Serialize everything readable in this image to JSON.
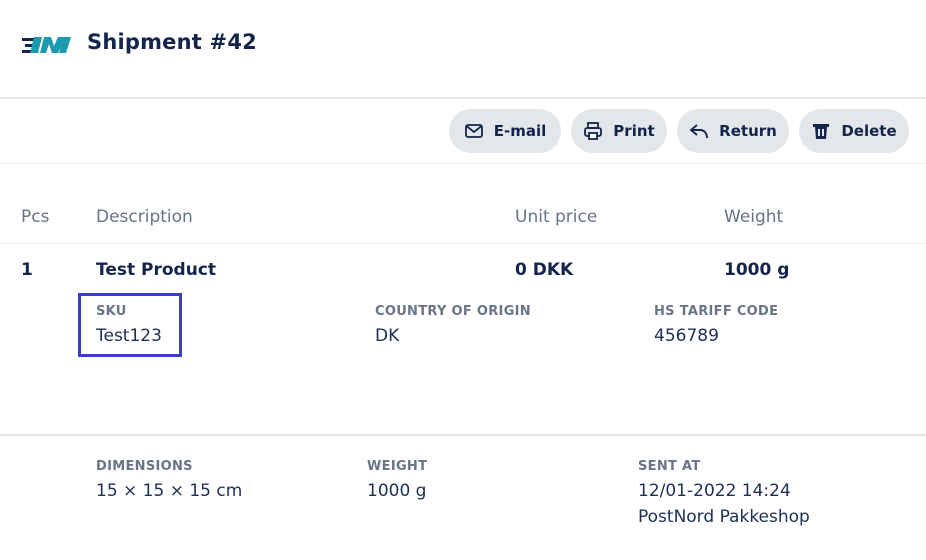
{
  "header": {
    "title": "Shipment #42",
    "logo": "company-logo"
  },
  "toolbar": {
    "email": "E-mail",
    "print": "Print",
    "return": "Return",
    "delete": "Delete"
  },
  "table": {
    "columns": [
      "Pcs",
      "Description",
      "Unit price",
      "Weight"
    ],
    "rows": [
      {
        "pcs": "1",
        "description": "Test Product",
        "unit_price": "0 DKK",
        "weight": "1000 g",
        "details": {
          "sku_label": "SKU",
          "sku": "Test123",
          "origin_label": "COUNTRY OF ORIGIN",
          "origin": "DK",
          "hs_label": "HS TARIFF CODE",
          "hs": "456789"
        }
      }
    ]
  },
  "summary": {
    "dimensions_label": "DIMENSIONS",
    "dimensions": "15 × 15 × 15 cm",
    "weight_label": "WEIGHT",
    "weight": "1000 g",
    "sent_at_label": "SENT AT",
    "sent_at": "12/01-2022 14:24",
    "sent_via": "PostNord Pakkeshop"
  },
  "colors": {
    "accent": "#13254a",
    "logo": "#1a9bb0",
    "highlight": "#3a3fc4",
    "button_bg": "#e4e7ea"
  }
}
